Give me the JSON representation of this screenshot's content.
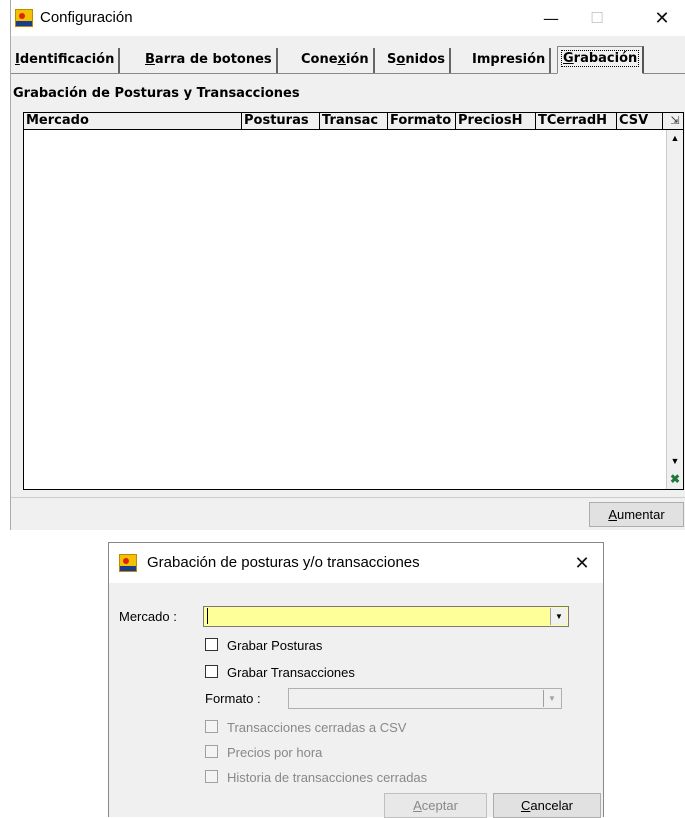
{
  "main_window": {
    "title": "Configuración",
    "controls": {
      "minimize": "—",
      "maximize": "☐",
      "close": "✕"
    },
    "tabs": [
      {
        "pre": "",
        "key": "I",
        "post": "dentificación"
      },
      {
        "pre": "",
        "key": "B",
        "post": "arra de botones"
      },
      {
        "pre": "Cone",
        "key": "x",
        "post": "ión"
      },
      {
        "pre": "S",
        "key": "o",
        "post": "nidos"
      },
      {
        "pre": "Impresión",
        "key": "",
        "post": ""
      },
      {
        "pre": "",
        "key": "G",
        "post": "rabación",
        "active": true
      }
    ],
    "section_title": "Grabación de Posturas y Transacciones",
    "grid_columns": [
      "Mercado",
      "Posturas",
      "Transac",
      "Formato",
      "PreciosH",
      "TCerradH",
      "CSV"
    ],
    "add_button": {
      "key": "A",
      "rest": "umentar"
    }
  },
  "dialog": {
    "title": "Grabación de posturas y/o transacciones",
    "close": "✕",
    "mercado_label": "Mercado :",
    "mercado_value": "",
    "mercado_bg": "#ffff99",
    "checkboxes": {
      "grabar_posturas": "Grabar Posturas",
      "grabar_transacciones": "Grabar Transacciones",
      "transacciones_csv": "Transacciones cerradas a CSV",
      "precios_por_hora": "Precios por hora",
      "historia": "Historia de transacciones cerradas"
    },
    "formato_label": "Formato :",
    "formato_value": "",
    "accept_button": {
      "key": "A",
      "rest": "ceptar"
    },
    "cancel_button": {
      "key": "C",
      "rest": "ancelar"
    }
  },
  "icons": {
    "app": "app-logo-icon",
    "export": "export-icon",
    "excel": "excel-icon"
  }
}
